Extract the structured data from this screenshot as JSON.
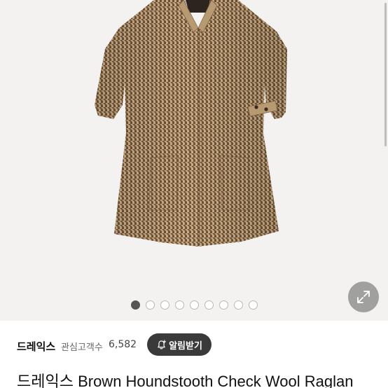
{
  "gallery": {
    "image_description_icon": "houndstooth-coat-image",
    "pager_total": 9,
    "pager_active": 0,
    "expand_icon": "expand-arrows-icon"
  },
  "seller": {
    "store_name": "드레익스",
    "follower_label": "관심고객수",
    "follower_count": "6,582",
    "notify_label": "알림받기",
    "notify_icon": "bell-plus-icon"
  },
  "product": {
    "title": "드레익스 Brown Houndstooth Check Wool Raglan"
  },
  "colors": {
    "notify_bg": "#3a3a3a",
    "pager_active": "#555555",
    "coat_base": "#b59a78"
  }
}
